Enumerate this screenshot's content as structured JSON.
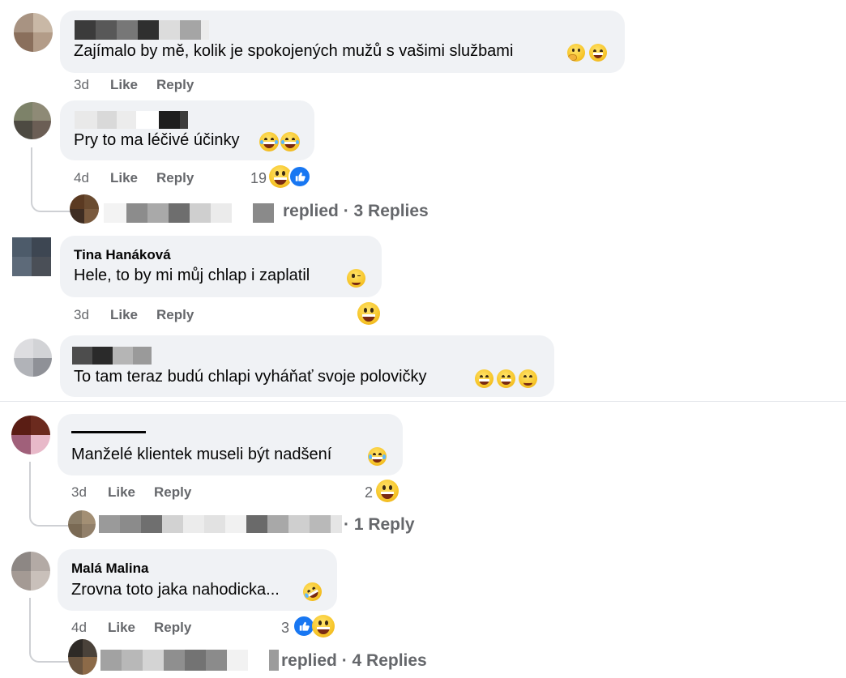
{
  "actions": {
    "like": "Like",
    "reply": "Reply"
  },
  "comments": [
    {
      "name": "",
      "text": "Zajímalo by mě, kolik je spokojených mužů s vašimi službami",
      "time": "3d",
      "text_emojis": [
        "thinking-face-icon",
        "face-with-open-mouth-vomiting-icon"
      ]
    },
    {
      "name": "",
      "text": "Pry to ma léčivé účinky",
      "time": "4d",
      "reaction_count": "19",
      "text_emojis": [
        "face-with-tears-of-joy-icon",
        "face-with-tears-of-joy-icon"
      ],
      "reactions": [
        "grinning-face-icon",
        "like-reaction-icon"
      ],
      "replies_summary": "replied · 3 Replies"
    },
    {
      "name": "Tina Hanáková",
      "text": "Hele, to by mi můj chlap i zaplatil",
      "time": "3d",
      "text_emojis": [
        "winking-face-icon"
      ],
      "reactions": [
        "grinning-face-icon"
      ]
    },
    {
      "name": "",
      "text": "To tam teraz budú chlapi vyháňať svoje polovičky",
      "time": "",
      "text_emojis": [
        "beaming-face-icon",
        "beaming-face-icon",
        "relieved-face-icon"
      ]
    },
    {
      "name": "",
      "text": "Manželé klientek museli být nadšení",
      "time": "3d",
      "reaction_count": "2",
      "text_emojis": [
        "face-with-tears-of-joy-icon"
      ],
      "reactions": [
        "grinning-face-icon"
      ],
      "replies_summary": "· 1 Reply"
    },
    {
      "name": "Malá Malina",
      "text": "Zrovna toto jaka nahodicka...",
      "time": "4d",
      "reaction_count": "3",
      "text_emojis": [
        "rolling-on-floor-laughing-icon"
      ],
      "reactions": [
        "like-reaction-icon",
        "grinning-face-icon"
      ],
      "replies_summary": "replied · 4 Replies"
    }
  ],
  "colors": {
    "bubble": "#f0f2f5",
    "meta_text": "#65676b",
    "like_blue": "#1877f2",
    "connector": "#ced0d4"
  }
}
